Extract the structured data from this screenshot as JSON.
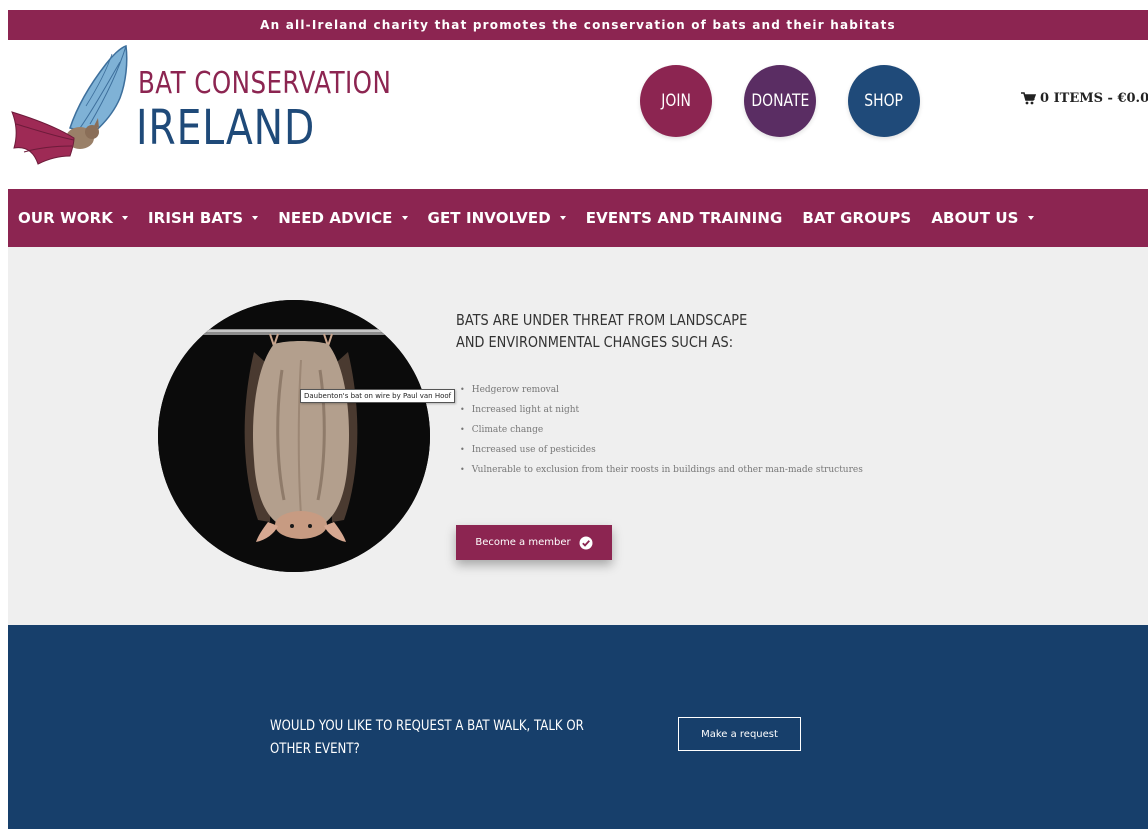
{
  "topbar": {
    "text": "An all-Ireland charity that promotes the conservation of bats and their habitats"
  },
  "header": {
    "logo_line1": "BAT CONSERVATION",
    "logo_line2": "IRELAND",
    "join_label": "JOIN",
    "donate_label": "DONATE",
    "shop_label": "SHOP",
    "cart_text": "0 ITEMS - €0.00"
  },
  "nav": {
    "items": [
      {
        "label": "OUR WORK",
        "dropdown": true
      },
      {
        "label": "IRISH BATS",
        "dropdown": true
      },
      {
        "label": "NEED ADVICE",
        "dropdown": true
      },
      {
        "label": "GET INVOLVED",
        "dropdown": true
      },
      {
        "label": "EVENTS AND TRAINING",
        "dropdown": false
      },
      {
        "label": "BAT GROUPS",
        "dropdown": false
      },
      {
        "label": "ABOUT US",
        "dropdown": true
      }
    ]
  },
  "hero": {
    "image_tooltip": "Daubenton's bat on wire by Paul van Hoof",
    "heading": "BATS ARE UNDER THREAT FROM LANDSCAPE AND ENVIRONMENTAL CHANGES SUCH AS:",
    "threats": [
      "Hedgerow removal",
      "Increased light at night",
      "Climate change",
      "Increased use of pesticides",
      "Vulnerable to exclusion from their roosts in buildings and other man-made structures"
    ],
    "member_button": "Become a member"
  },
  "cta": {
    "text": "WOULD YOU LIKE TO REQUEST A BAT WALK, TALK OR OTHER EVENT?",
    "button": "Make a request"
  },
  "colors": {
    "maroon": "#8c2551",
    "purple": "#5a2d63",
    "navy": "#1f4a79",
    "band_blue": "#173f6b",
    "hero_bg": "#efefef"
  },
  "icons": {
    "cart": "cart-icon",
    "check": "check-circle-icon",
    "caret": "caret-down-icon"
  }
}
